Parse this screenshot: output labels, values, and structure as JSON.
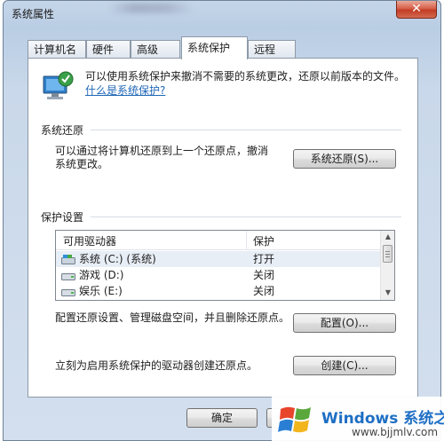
{
  "window": {
    "title": "系统属性",
    "close_glyph": "✕"
  },
  "tabs": [
    {
      "label": "计算机名",
      "active": false
    },
    {
      "label": "硬件",
      "active": false
    },
    {
      "label": "高级",
      "active": false
    },
    {
      "label": "系统保护",
      "active": true
    },
    {
      "label": "远程",
      "active": false
    }
  ],
  "intro": {
    "text": "可以使用系统保护来撤消不需要的系统更改，还原以前版本的文件。",
    "link": "什么是系统保护?"
  },
  "system_restore": {
    "title": "系统还原",
    "text": "可以通过将计算机还原到上一个还原点，撤消系统更改。",
    "button": "系统还原(S)..."
  },
  "protection_settings": {
    "title": "保护设置",
    "columns": [
      "可用驱动器",
      "保护"
    ],
    "drives": [
      {
        "name": "系统 (C:) (系统)",
        "status": "打开",
        "icon": "system-drive-icon"
      },
      {
        "name": "游戏 (D:)",
        "status": "关闭",
        "icon": "hard-drive-icon"
      },
      {
        "name": "娱乐 (E:)",
        "status": "关闭",
        "icon": "hard-drive-icon"
      }
    ],
    "config_text": "配置还原设置、管理磁盘空间，并且删除还原点。",
    "config_button": "配置(O)...",
    "create_text": "立刻为启用系统保护的驱动器创建还原点。",
    "create_button": "创建(C)..."
  },
  "footer": {
    "ok_button": "确定"
  },
  "watermark": {
    "brand": "Windows",
    "brand_cn": "系统之家",
    "url": "www.bjjmlv.com"
  }
}
